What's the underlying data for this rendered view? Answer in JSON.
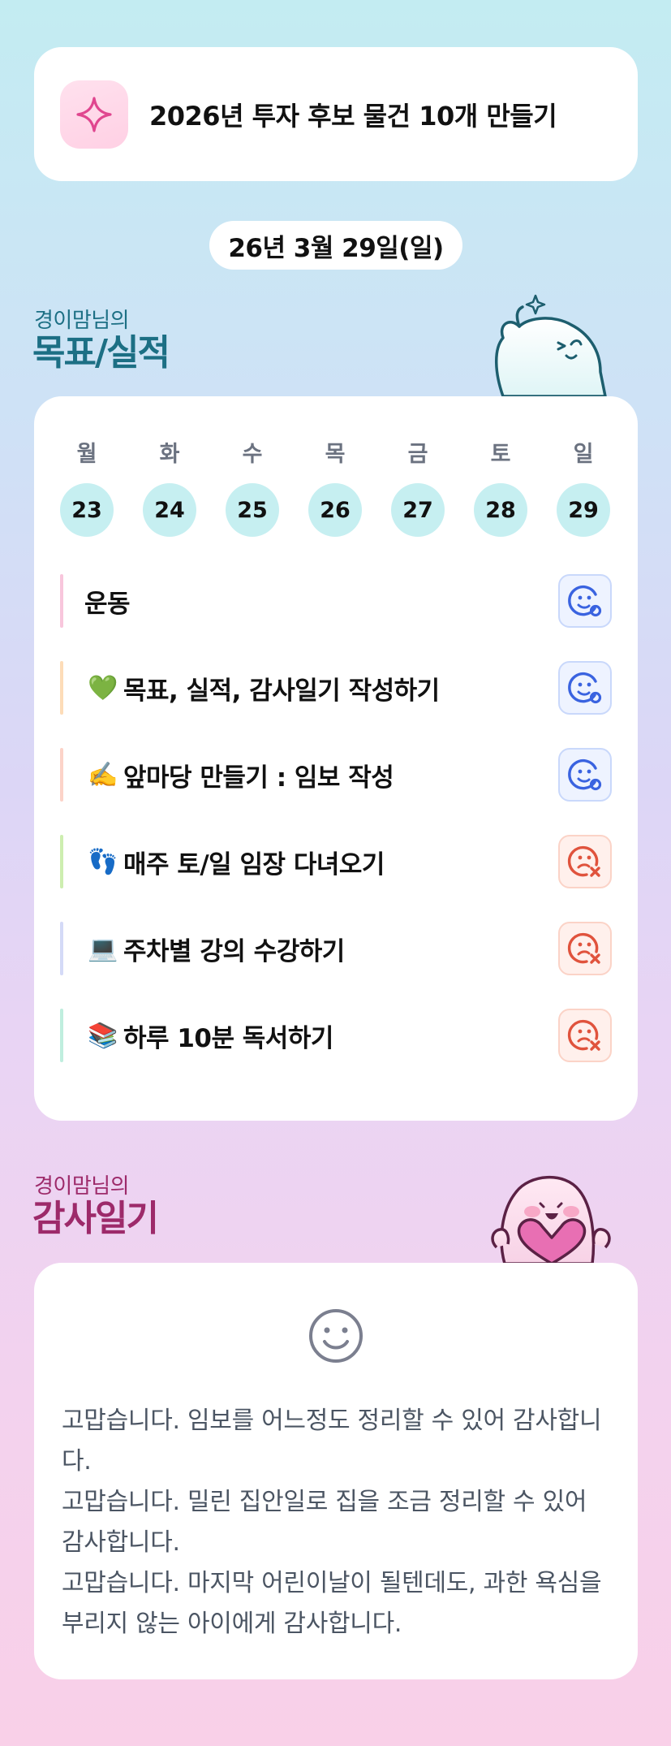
{
  "goal": {
    "icon": "sparkle-icon",
    "text": "2026년 투자 후보 물건 10개 만들기"
  },
  "date": "26년 3월 29일(일)",
  "goals_section": {
    "subtitle": "경이맘님의",
    "title": "목표/실적",
    "mascot": "waving-mascot"
  },
  "week": {
    "days": [
      {
        "name": "월",
        "num": "23"
      },
      {
        "name": "화",
        "num": "24"
      },
      {
        "name": "수",
        "num": "25"
      },
      {
        "name": "목",
        "num": "26"
      },
      {
        "name": "금",
        "num": "27"
      },
      {
        "name": "토",
        "num": "28"
      },
      {
        "name": "일",
        "num": "29"
      }
    ]
  },
  "tasks": [
    {
      "emoji": "",
      "label": "운동",
      "status": "done",
      "bar_color": "#f8c6dc"
    },
    {
      "emoji": "💚",
      "label": "목표, 실적, 감사일기 작성하기",
      "status": "done",
      "bar_color": "#fddcb8"
    },
    {
      "emoji": "✍️",
      "label": "앞마당 만들기 : 임보 작성",
      "status": "done",
      "bar_color": "#fcd3c8"
    },
    {
      "emoji": "👣",
      "label": "매주 토/일 임장 다녀오기",
      "status": "not-done",
      "bar_color": "#cdeeb0"
    },
    {
      "emoji": "💻",
      "label": "주차별 강의 수강하기",
      "status": "not-done",
      "bar_color": "#d4daf7"
    },
    {
      "emoji": "📚",
      "label": "하루 10분 독서하기",
      "status": "not-done",
      "bar_color": "#bfeede"
    }
  ],
  "status_icons": {
    "done": "smile-check-icon",
    "not-done": "frown-x-icon"
  },
  "colors": {
    "done": "#3a63e0",
    "not_done": "#e0533d",
    "teal": "#1c6f84",
    "pink": "#9d2a6a"
  },
  "diary_section": {
    "subtitle": "경이맘님의",
    "title": "감사일기",
    "mascot": "heart-mascot"
  },
  "diary": {
    "mood_icon": "smiley-icon",
    "lines": [
      "고맙습니다. 임보를 어느정도 정리할 수 있어 감사합니다.",
      "고맙습니다. 밀린 집안일로 집을 조금 정리할 수 있어 감사합니다.",
      "고맙습니다. 마지막 어린이날이 될텐데도, 과한 욕심을 부리지 않는 아이에게 감사합니다."
    ]
  }
}
